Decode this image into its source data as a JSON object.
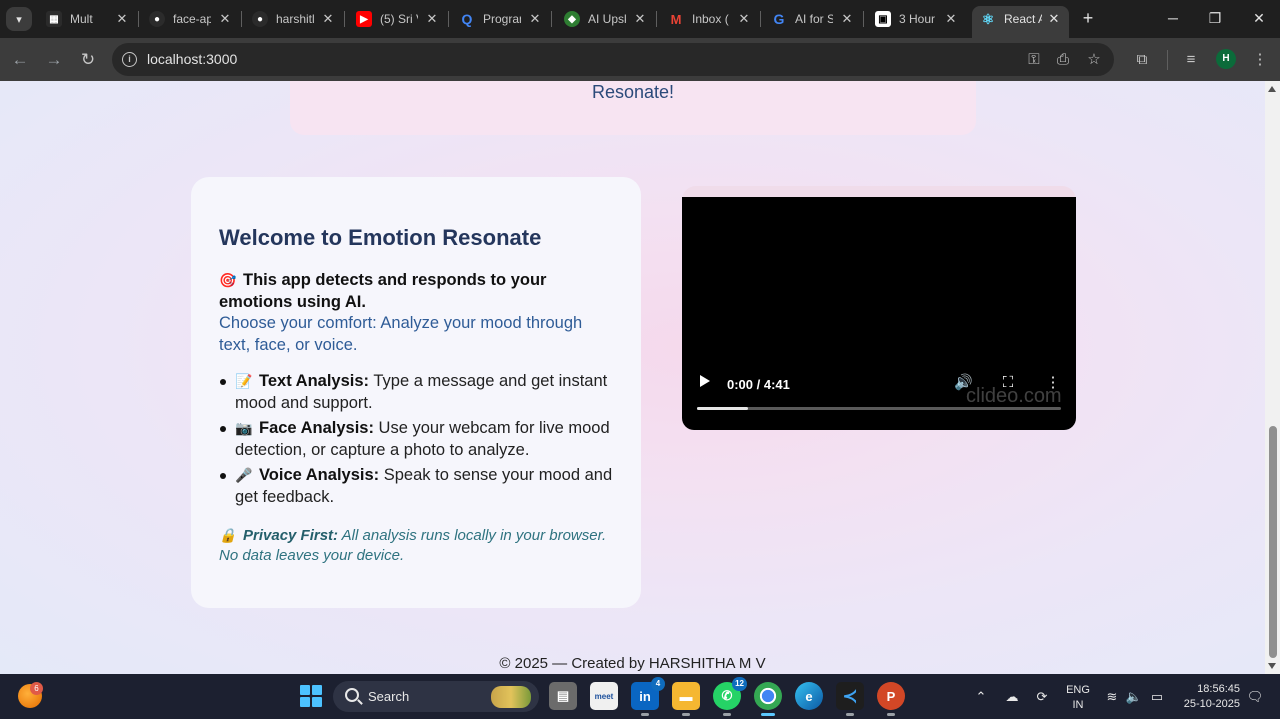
{
  "browser": {
    "tabs": [
      {
        "title": "Mult",
        "favicon": "calendar-favicon",
        "color": "#2b2b2b"
      },
      {
        "title": "face-ap",
        "favicon": "github-favicon",
        "color": "#2b2b2b"
      },
      {
        "title": "harshitl",
        "favicon": "github-favicon",
        "color": "#2b2b2b"
      },
      {
        "title": "(5) Sri V",
        "favicon": "youtube-favicon",
        "color": "#ff0000"
      },
      {
        "title": "Progran",
        "favicon": "search-favicon",
        "color": "#1a73e8"
      },
      {
        "title": "AI Upsk",
        "favicon": "shield-favicon",
        "color": "#2e7d32"
      },
      {
        "title": "Inbox (",
        "favicon": "gmail-favicon",
        "color": "#ea4335"
      },
      {
        "title": "AI for S",
        "favicon": "google-favicon",
        "color": "#4285f4"
      },
      {
        "title": "3 Hour",
        "favicon": "clapper-favicon",
        "color": "#ffffff"
      },
      {
        "title": "React A",
        "favicon": "react-favicon",
        "color": "#61dafb"
      }
    ],
    "url": "localhost:3000",
    "profile_initial": "H"
  },
  "page": {
    "hero_text": "Resonate!",
    "welcome": {
      "title": "Welcome to Emotion Resonate",
      "lead_emoji": "🎯",
      "lead": "This app detects and responds to your emotions using AI.",
      "subtitle": "Choose your comfort: Analyze your mood through text, face, or voice.",
      "features": [
        {
          "emoji": "📝",
          "name": "Text Analysis:",
          "desc": "Type a message and get instant mood and support."
        },
        {
          "emoji": "📷",
          "name": "Face Analysis:",
          "desc": "Use your webcam for live mood detection, or capture a photo to analyze."
        },
        {
          "emoji": "🎤",
          "name": "Voice Analysis:",
          "desc": "Speak to sense your mood and get feedback."
        }
      ],
      "privacy_emoji": "🔒",
      "privacy_title": "Privacy First:",
      "privacy_text": "All analysis runs locally in your browser. No data leaves your device."
    },
    "video": {
      "time": "0:00 / 4:41",
      "watermark": "clideo.com",
      "progress_fraction": 0.14
    },
    "footer": "© 2025 — Created by HARSHITHA M V"
  },
  "taskbar": {
    "weather_badge": "6",
    "search_label": "Search",
    "apps": [
      {
        "name": "file-explorer-app",
        "badge": ""
      },
      {
        "name": "wemeet-app",
        "badge": ""
      },
      {
        "name": "linkedin-app",
        "badge": "4"
      },
      {
        "name": "folder-app",
        "badge": ""
      },
      {
        "name": "whatsapp-app",
        "badge": "12"
      },
      {
        "name": "chrome-app",
        "badge": ""
      },
      {
        "name": "edge-app",
        "badge": ""
      },
      {
        "name": "vscode-app",
        "badge": ""
      },
      {
        "name": "powerpoint-app",
        "badge": ""
      }
    ],
    "lang_line1": "ENG",
    "lang_line2": "IN",
    "time": "18:56:45",
    "date": "25-10-2025"
  }
}
